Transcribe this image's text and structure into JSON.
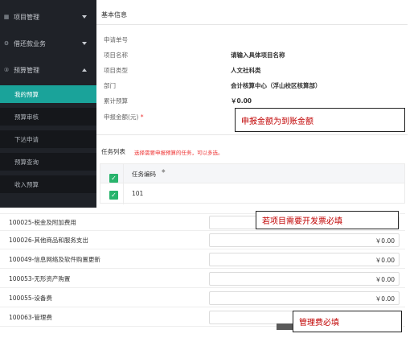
{
  "sidebar": {
    "menus": [
      {
        "label": "项目管理",
        "icon": "grid-icon",
        "expanded": false
      },
      {
        "label": "借还款业务",
        "icon": "gear-icon",
        "expanded": false
      },
      {
        "label": "预算管理",
        "icon": "coin-icon",
        "expanded": true
      }
    ],
    "sub_items": [
      {
        "label": "我的预算",
        "active": true
      },
      {
        "label": "预算审核",
        "active": false
      },
      {
        "label": "下达申请",
        "active": false
      },
      {
        "label": "预算查询",
        "active": false
      },
      {
        "label": "收入预算",
        "active": false
      }
    ]
  },
  "basic_info": {
    "title": "基本信息",
    "fields": [
      {
        "label": "申请单号",
        "value": ""
      },
      {
        "label": "项目名称",
        "value": "请输入具体项目名称"
      },
      {
        "label": "项目类型",
        "value": "人文社科类"
      },
      {
        "label": "部门",
        "value": "会计核算中心（浮山校区核算部）"
      },
      {
        "label": "累计预算",
        "value": "￥0.00"
      },
      {
        "label": "申报金额(元)",
        "value": "",
        "required_mark": "*"
      }
    ]
  },
  "task_list": {
    "title": "任务列表",
    "hint": "选择需要申报预算的任务，可以多选。",
    "column_header": "任务编码",
    "rows": [
      {
        "code": "101",
        "checked": true
      }
    ]
  },
  "budget_items": [
    {
      "label": "100025-税金及附加费用",
      "value": ""
    },
    {
      "label": "100026-其他商品和服务支出",
      "value": "￥0.00"
    },
    {
      "label": "100049-信息网络及软件购置更新",
      "value": "￥0.00"
    },
    {
      "label": "100053-无形资产购置",
      "value": "￥0.00"
    },
    {
      "label": "100055-设备费",
      "value": "￥0.00"
    },
    {
      "label": "100063-管理费",
      "value": ""
    }
  ],
  "annotations": {
    "amount_note": "申报金额为到账金额",
    "invoice_note": "若项目需要开发票必填",
    "management_note": "管理费必填"
  },
  "colors": {
    "sidebar_bg": "#1f2228",
    "active_item": "#1aa39a",
    "checkbox": "#28b46c",
    "required": "#e33333",
    "annotation_text": "#c00000"
  }
}
